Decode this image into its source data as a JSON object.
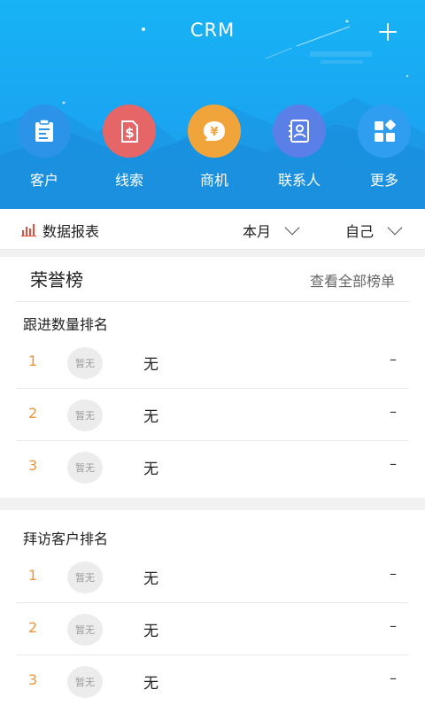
{
  "header": {
    "title": "CRM",
    "add_icon": "plus-icon"
  },
  "nav": {
    "items": [
      {
        "label": "客户",
        "icon": "customer-clipboard-icon",
        "color": "#2c94e8"
      },
      {
        "label": "线索",
        "icon": "lead-dollar-icon",
        "color": "#e66566"
      },
      {
        "label": "商机",
        "icon": "opportunity-yen-icon",
        "color": "#f1a43a"
      },
      {
        "label": "联系人",
        "icon": "contact-card-icon",
        "color": "#5a7fe6"
      },
      {
        "label": "更多",
        "icon": "more-grid-icon",
        "color": "#2f9ef0"
      }
    ]
  },
  "report": {
    "label": "数据报表",
    "period_filter": "本月",
    "owner_filter": "自己"
  },
  "honor": {
    "title": "荣誉榜",
    "view_all": "查看全部榜单"
  },
  "follow_up_ranking": {
    "title": "跟进数量排名",
    "rows": [
      {
        "rank": "1",
        "avatar": "暂无",
        "name": "无",
        "value": "–"
      },
      {
        "rank": "2",
        "avatar": "暂无",
        "name": "无",
        "value": "–"
      },
      {
        "rank": "3",
        "avatar": "暂无",
        "name": "无",
        "value": "–"
      }
    ]
  },
  "visit_ranking": {
    "title": "拜访客户排名",
    "rows": [
      {
        "rank": "1",
        "avatar": "暂无",
        "name": "无",
        "value": "–"
      },
      {
        "rank": "2",
        "avatar": "暂无",
        "name": "无",
        "value": "–"
      },
      {
        "rank": "3",
        "avatar": "暂无",
        "name": "无",
        "value": "–"
      }
    ]
  },
  "colors": {
    "header_blue": "#1aa6f2",
    "rank_orange": "#f0933a",
    "report_icon_red": "#e74c3c"
  }
}
